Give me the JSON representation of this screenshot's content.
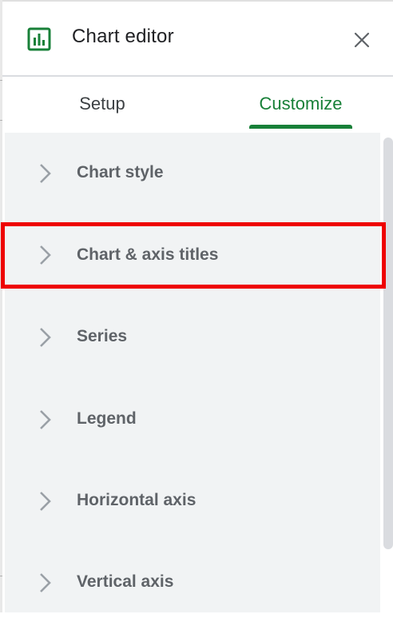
{
  "header": {
    "title": "Chart editor",
    "icon": "bar-chart-icon",
    "close_icon": "close-icon",
    "accent_color": "#188038"
  },
  "tabs": [
    {
      "label": "Setup",
      "active": false
    },
    {
      "label": "Customize",
      "active": true
    }
  ],
  "sections": [
    {
      "label": "Chart style",
      "icon": "chevron-right-icon"
    },
    {
      "label": "Chart & axis titles",
      "icon": "chevron-right-icon",
      "highlighted": true
    },
    {
      "label": "Series",
      "icon": "chevron-right-icon"
    },
    {
      "label": "Legend",
      "icon": "chevron-right-icon"
    },
    {
      "label": "Horizontal axis",
      "icon": "chevron-right-icon"
    },
    {
      "label": "Vertical axis",
      "icon": "chevron-right-icon"
    }
  ],
  "highlight_color": "#ee0000"
}
